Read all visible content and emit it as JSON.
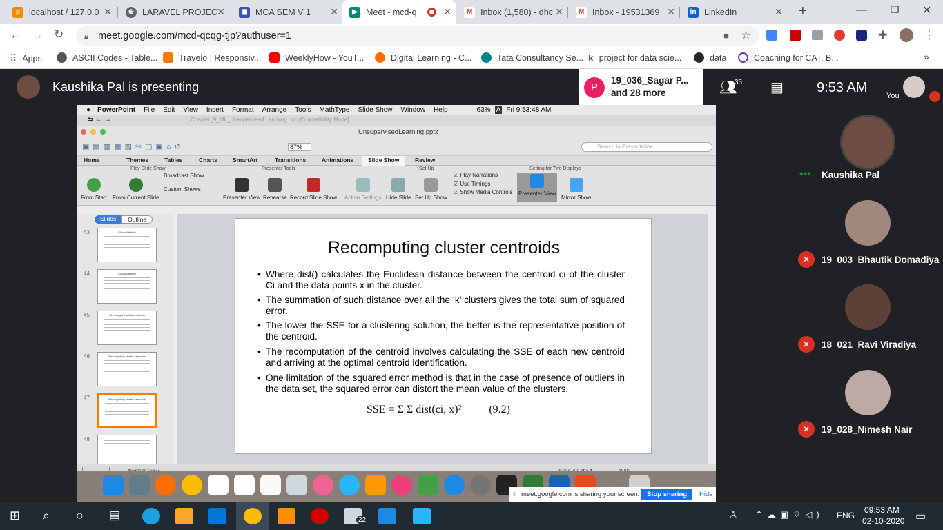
{
  "browser": {
    "tabs": [
      {
        "title": "localhost / 127.0.0",
        "color": "#f28b00"
      },
      {
        "title": "LARAVEL PROJECT",
        "color": "#5f6368"
      },
      {
        "title": "MCA SEM V 1",
        "color": "#3f51b5"
      },
      {
        "title": "Meet - mcd-q",
        "color": "#00897b"
      },
      {
        "title": "Inbox (1,580) - dhc",
        "color": "#d93025"
      },
      {
        "title": "Inbox - 19531369",
        "color": "#d93025"
      },
      {
        "title": "LinkedIn",
        "color": "#0a66c2"
      }
    ],
    "new_tab": "+",
    "url": "meet.google.com/mcd-qcqg-tjp?authuser=1",
    "bookmarks": [
      "Apps",
      "ASCII Codes - Table...",
      "Travelo | Responsiv...",
      "WeeklyHow - YouT...",
      "Digital Learning - C...",
      "Tata Consultancy Se...",
      "project for data scie...",
      "data",
      "Coaching for CAT, B..."
    ],
    "bookmarks_more": "»"
  },
  "meet": {
    "presenting": "Kaushika Pal is presenting",
    "participant_preview": "19_036_Sagar P...",
    "participant_more": "and 28 more",
    "participant_initial": "P",
    "people_count": "35",
    "time": "9:53 AM",
    "you_label": "You",
    "people": [
      {
        "name": "Kaushika Pal",
        "muted": false
      },
      {
        "name": "19_003_Bhautik Domadiya",
        "muted": true
      },
      {
        "name": "18_021_Ravi Viradiya",
        "muted": true
      },
      {
        "name": "19_028_Nimesh Nair",
        "muted": true
      }
    ]
  },
  "mac": {
    "app": "PowerPoint",
    "menus": [
      "File",
      "Edit",
      "View",
      "Insert",
      "Format",
      "Arrange",
      "Tools",
      "MathType",
      "Slide Show",
      "Window",
      "Help"
    ],
    "battery": "63%",
    "input_source": "A",
    "clock": "Fri 9:53:48 AM",
    "doc_tab": "Chapter_9_ML_Unsupervised Learning.doc [Compatibility Mode]",
    "window_title": "UnsupervisedLearning.pptx",
    "zoom": "87%",
    "search_placeholder": "Search in Presentation"
  },
  "ribbon": {
    "tabs": [
      "Home",
      "Themes",
      "Tables",
      "Charts",
      "SmartArt",
      "Transitions",
      "Animations",
      "Slide Show",
      "Review"
    ],
    "active_tab": "Slide Show",
    "groups": [
      "Play Slide Show",
      "Presenter Tools",
      "Set Up",
      "Setting for Two Displays"
    ],
    "buttons": [
      "From Start",
      "From Current Slide",
      "Broadcast Show",
      "Custom Shows",
      "Presenter View",
      "Rehearse",
      "Record Slide Show",
      "Action Settings",
      "Hide Slide",
      "Set Up Show",
      "Presenter View",
      "Mirror Show"
    ],
    "checks": [
      "Play Narrations",
      "Use Timings",
      "Show Media Controls"
    ]
  },
  "panel": {
    "tabs": [
      "Slides",
      "Outline"
    ],
    "thumb_numbers": [
      "43",
      "44",
      "45",
      "46",
      "47",
      "48"
    ],
    "thumb_titles": [
      "Elbow Method",
      "Elbow Method",
      "Choosing the initial centroids",
      "Recomputing cluster centroids",
      "Recomputing cluster centroids",
      ""
    ]
  },
  "slide": {
    "title": "Recomputing cluster centroids",
    "bullets": [
      "Where dist() calculates the Euclidean distance between the centroid ci of the cluster Ci and the data points x in the cluster.",
      "The summation of such distance over all the ‘k’ clusters gives the total sum of squared error.",
      "The lower the SSE for a clustering solution, the better is the representative position of the centroid.",
      "The recomputation of the centroid involves calculating the SSE of each new centroid and arriving at the optimal centroid identification.",
      "One limitation of the squared error method is that in the case of presence of outliers in the data set, the squared error can distort the mean value of the clusters."
    ],
    "formula": "SSE = Σ Σ dist(ci, x)²",
    "eq_number": "(9.2)"
  },
  "status": {
    "view": "Normal View",
    "slide_of": "Slide 47 of 54",
    "zoom": "87%"
  },
  "sharebar": {
    "text": "meet.google.com is sharing your screen.",
    "stop": "Stop sharing",
    "hide": "Hide"
  },
  "taskbar": {
    "badge": "22",
    "lang": "ENG",
    "time": "09:53 AM",
    "date": "02-10-2020"
  }
}
